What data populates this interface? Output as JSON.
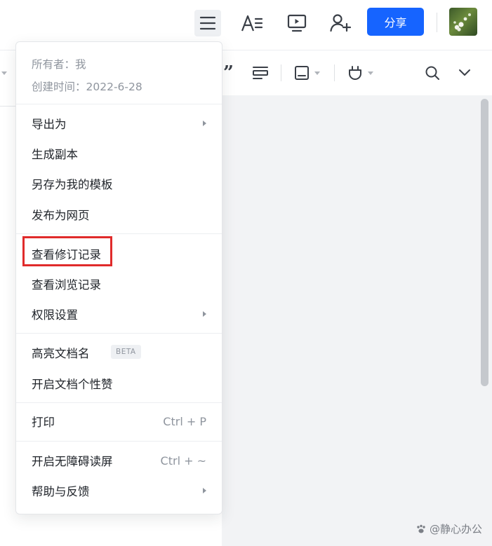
{
  "header": {
    "share_label": "分享",
    "icons": [
      "menu-icon",
      "text-style-icon",
      "presentation-icon",
      "add-user-icon"
    ],
    "avatar_alt": "avatar"
  },
  "toolbar": {
    "quote_glyph": "”",
    "icons": [
      "quote-icon",
      "align-icon",
      "insert-block-icon",
      "plugin-icon",
      "search-icon",
      "chevron-down-icon"
    ]
  },
  "menu": {
    "owner": "所有者：我",
    "created": "创建时间：2022-6-28",
    "groups": [
      [
        {
          "label": "导出为",
          "submenu": true
        },
        {
          "label": "生成副本"
        },
        {
          "label": "另存为我的模板"
        },
        {
          "label": "发布为网页"
        }
      ],
      [
        {
          "label": "查看修订记录",
          "highlighted": true
        },
        {
          "label": "查看浏览记录"
        },
        {
          "label": "权限设置",
          "submenu": true
        }
      ],
      [
        {
          "label": "高亮文档名",
          "badge": "BETA"
        },
        {
          "label": "开启文档个性赞"
        }
      ],
      [
        {
          "label": "打印",
          "shortcut": "Ctrl + P"
        }
      ],
      [
        {
          "label": "开启无障碍读屏",
          "shortcut": "Ctrl + ~"
        },
        {
          "label": "帮助与反馈",
          "submenu": true
        }
      ]
    ]
  },
  "watermark": "@静心办公",
  "colors": {
    "accent": "#1664ff",
    "highlight_box": "#e02b2b",
    "canvas": "#f2f3f5"
  }
}
